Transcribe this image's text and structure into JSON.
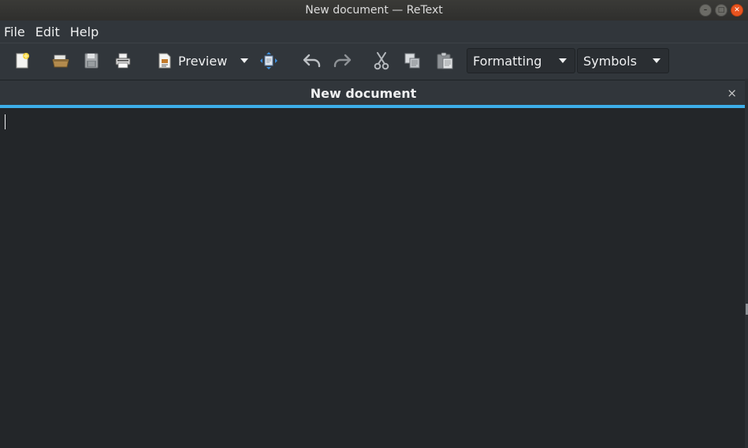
{
  "window": {
    "title": "New document — ReText"
  },
  "menubar": {
    "items": [
      "File",
      "Edit",
      "Help"
    ]
  },
  "toolbar": {
    "new_icon": "new-document-icon",
    "open_icon": "open-folder-icon",
    "save_icon": "save-icon",
    "print_icon": "print-icon",
    "preview_label": "Preview",
    "live_preview_icon": "live-preview-icon",
    "undo_icon": "undo-icon",
    "redo_icon": "redo-icon",
    "cut_icon": "cut-icon",
    "copy_icon": "copy-icon",
    "paste_icon": "paste-icon",
    "formatting_value": "Formatting",
    "symbols_value": "Symbols"
  },
  "tab": {
    "title": "New document",
    "close_glyph": "×"
  },
  "editor": {
    "content": ""
  },
  "colors": {
    "accent": "#3daee9",
    "background": "#232629",
    "chrome": "#31363b",
    "close_button": "#e9541f"
  }
}
